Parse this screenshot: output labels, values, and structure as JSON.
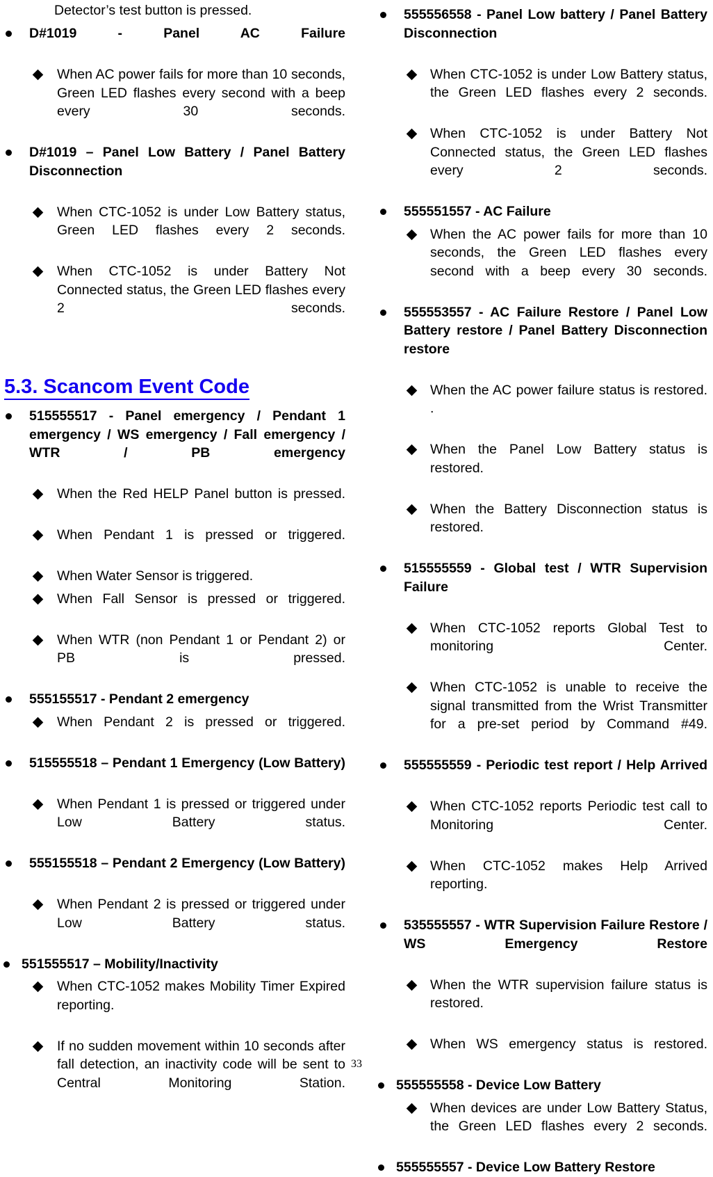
{
  "page": {
    "number": "33"
  },
  "left_column": {
    "continuation": "Detector’s test button is pressed.",
    "items": [
      {
        "title": "D#1019 - Panel AC Failure",
        "subitems": [
          "When AC power fails for more than 10 seconds, Green LED flashes every second with a beep every 30 seconds."
        ]
      },
      {
        "title": "D#1019 – Panel Low Battery / Panel Battery Disconnection",
        "subitems": [
          "When CTC-1052 is under Low Battery status, Green LED flashes every 2 seconds.",
          "When CTC-1052 is under Battery Not Connected status, the Green LED flashes every 2 seconds."
        ]
      }
    ],
    "heading": "5.3. Scancom Event Code",
    "items2": [
      {
        "title": "515555517 - Panel emergency / Pendant 1 emergency / WS emergency / Fall emergency / WTR / PB emergency",
        "subitems": [
          "When the Red HELP Panel button is pressed.",
          "When Pendant 1 is pressed or triggered.",
          "When Water Sensor is triggered.",
          "When Fall Sensor is pressed or triggered.",
          "When WTR (non Pendant 1 or Pendant 2) or PB is pressed."
        ]
      },
      {
        "title": "555155517 - Pendant 2 emergency",
        "subitems": [
          "When Pendant 2 is pressed or triggered."
        ]
      },
      {
        "title": "515555518 – Pendant 1 Emergency (Low Battery)",
        "subitems": [
          "When Pendant 1 is pressed or triggered under Low Battery status."
        ]
      },
      {
        "title": "555155518 – Pendant 2 Emergency (Low Battery)",
        "subitems": [
          "When Pendant 2 is pressed or triggered under Low Battery status."
        ]
      },
      {
        "title": "551555517 – Mobility/Inactivity",
        "tight": true,
        "subitems": [
          "When CTC-1052 makes Mobility Timer Expired reporting.",
          "If no sudden movement within 10 seconds after fall detection, an inactivity code will be sent to Central Monitoring  Station."
        ]
      }
    ]
  },
  "right_column": {
    "items": [
      {
        "title": "555556558 - Panel Low battery / Panel Battery Disconnection",
        "subitems": [
          "When CTC-1052 is under Low Battery status, the Green LED flashes every 2 seconds.",
          "When CTC-1052 is under Battery Not Connected status, the Green LED flashes every 2 seconds."
        ]
      },
      {
        "title": "555551557 - AC Failure",
        "subitems": [
          "When the AC power fails for more than 10 seconds, the Green LED flashes every second with a beep every 30 seconds."
        ]
      },
      {
        "title": "555553557 - AC Failure Restore / Panel Low Battery restore / Panel Battery Disconnection restore",
        "subitems": [
          "When the AC power failure status is restored. .",
          "When the Panel Low Battery status is restored.",
          "When the Battery Disconnection status is restored."
        ]
      },
      {
        "title": "515555559 - Global test / WTR Supervision Failure",
        "subitems": [
          "When CTC-1052 reports Global Test to monitoring Center.",
          "When CTC-1052 is unable to receive the signal transmitted from the Wrist Transmitter for a pre-set period by Command #49."
        ]
      },
      {
        "title": "555555559 - Periodic test report / Help Arrived",
        "subitems": [
          "When CTC-1052 reports Periodic test call to Monitoring Center.",
          "When CTC-1052 makes Help Arrived reporting."
        ]
      },
      {
        "title": "535555557 - WTR Supervision Failure Restore / WS Emergency Restore",
        "subitems": [
          "When the WTR supervision failure status is restored.",
          "When WS emergency status is restored."
        ]
      },
      {
        "title": "555555558 - Device Low Battery",
        "tight": true,
        "subitems": [
          "When devices are under Low Battery Status, the Green LED flashes every 2 seconds."
        ]
      },
      {
        "title": "555555557 - Device Low Battery Restore",
        "tight": true,
        "subitems": []
      }
    ]
  },
  "colors": {
    "heading": "#1400F0",
    "text": "#000000",
    "background": "#FFFFFF"
  }
}
